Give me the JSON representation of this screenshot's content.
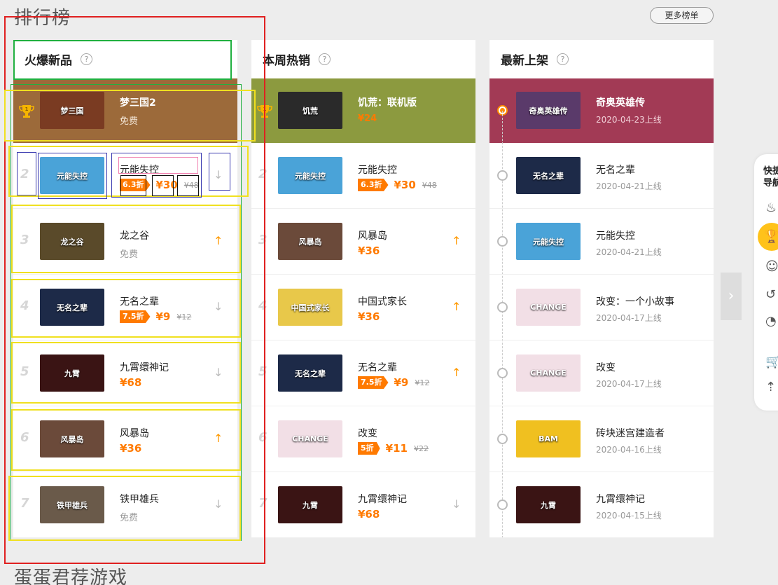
{
  "page": {
    "title": "排行榜",
    "more_button": "更多榜单",
    "bottom_title": "蛋蛋君荐游戏"
  },
  "columns": [
    {
      "header": "火爆新品",
      "top": {
        "name": "梦三国2",
        "sub": "免费",
        "bg": "#9c6a3a",
        "thumb_color": "#7a3b22",
        "thumb_text": "梦三国"
      },
      "rows": [
        {
          "rank": "2",
          "name": "元能失控",
          "discount": "6.3折",
          "price": "¥30",
          "orig": "¥48",
          "trend": "down",
          "thumb_color": "#4aa3d8",
          "thumb_text": "元能失控"
        },
        {
          "rank": "3",
          "name": "龙之谷",
          "sub": "免费",
          "trend": "up",
          "thumb_color": "#5a4a2a",
          "thumb_text": "龙之谷"
        },
        {
          "rank": "4",
          "name": "无名之辈",
          "discount": "7.5折",
          "price": "¥9",
          "orig": "¥12",
          "trend": "down",
          "thumb_color": "#1d2a48",
          "thumb_text": "无名之辈"
        },
        {
          "rank": "5",
          "name": "九霄缳神记",
          "price": "¥68",
          "trend": "down",
          "thumb_color": "#3a1414",
          "thumb_text": "九霄"
        },
        {
          "rank": "6",
          "name": "风暴岛",
          "price": "¥36",
          "trend": "up",
          "thumb_color": "#6b4a3a",
          "thumb_text": "风暴岛"
        },
        {
          "rank": "7",
          "name": "铁甲雄兵",
          "sub": "免费",
          "trend": "down",
          "thumb_color": "#6a5a4a",
          "thumb_text": "铁甲雄兵"
        }
      ]
    },
    {
      "header": "本周热销",
      "top": {
        "name": "饥荒：联机版",
        "sub": "¥24",
        "bg": "#8c9a3f",
        "thumb_color": "#2a2a2a",
        "thumb_text": "饥荒"
      },
      "rows": [
        {
          "rank": "2",
          "name": "元能失控",
          "discount": "6.3折",
          "price": "¥30",
          "orig": "¥48",
          "trend": "",
          "thumb_color": "#4aa3d8",
          "thumb_text": "元能失控"
        },
        {
          "rank": "3",
          "name": "风暴岛",
          "price": "¥36",
          "trend": "up",
          "thumb_color": "#6b4a3a",
          "thumb_text": "风暴岛"
        },
        {
          "rank": "4",
          "name": "中国式家长",
          "price": "¥36",
          "trend": "up",
          "thumb_color": "#e8c84a",
          "thumb_text": "中国式家长"
        },
        {
          "rank": "5",
          "name": "无名之辈",
          "discount": "7.5折",
          "price": "¥9",
          "orig": "¥12",
          "trend": "up",
          "thumb_color": "#1d2a48",
          "thumb_text": "无名之辈"
        },
        {
          "rank": "6",
          "name": "改变",
          "discount": "5折",
          "price": "¥11",
          "orig": "¥22",
          "trend": "",
          "thumb_color": "#f2dfe6",
          "thumb_text": "CHANGE"
        },
        {
          "rank": "7",
          "name": "九霄缳神记",
          "price": "¥68",
          "trend": "down",
          "thumb_color": "#3a1414",
          "thumb_text": "九霄"
        }
      ]
    },
    {
      "header": "最新上架",
      "top": {
        "name": "奇奥英雄传",
        "sub": "2020-04-23上线",
        "bg": "#a23a55",
        "thumb_color": "#5a3a6a",
        "thumb_text": "奇奥英雄传"
      },
      "rows": [
        {
          "name": "无名之辈",
          "date": "2020-04-21上线",
          "thumb_color": "#1d2a48",
          "thumb_text": "无名之辈"
        },
        {
          "name": "元能失控",
          "date": "2020-04-21上线",
          "thumb_color": "#4aa3d8",
          "thumb_text": "元能失控"
        },
        {
          "name": "改变：一个小故事",
          "date": "2020-04-17上线",
          "thumb_color": "#f2dfe6",
          "thumb_text": "CHANGE"
        },
        {
          "name": "改变",
          "date": "2020-04-17上线",
          "thumb_color": "#f2dfe6",
          "thumb_text": "CHANGE"
        },
        {
          "name": "砖块迷宫建造者",
          "date": "2020-04-16上线",
          "thumb_color": "#f0c020",
          "thumb_text": "BAM"
        },
        {
          "name": "九霄缳神记",
          "date": "2020-04-15上线",
          "thumb_color": "#3a1414",
          "thumb_text": "九霄"
        }
      ]
    }
  ],
  "quick_nav": {
    "title_line1": "快捷",
    "title_line2": "导航"
  },
  "annotation_colors": {
    "red": "#e02020",
    "green": "#20b040",
    "yellow": "#f0e020",
    "blue": "#3a3ab0",
    "pink": "#f080b0",
    "black": "#111111"
  }
}
